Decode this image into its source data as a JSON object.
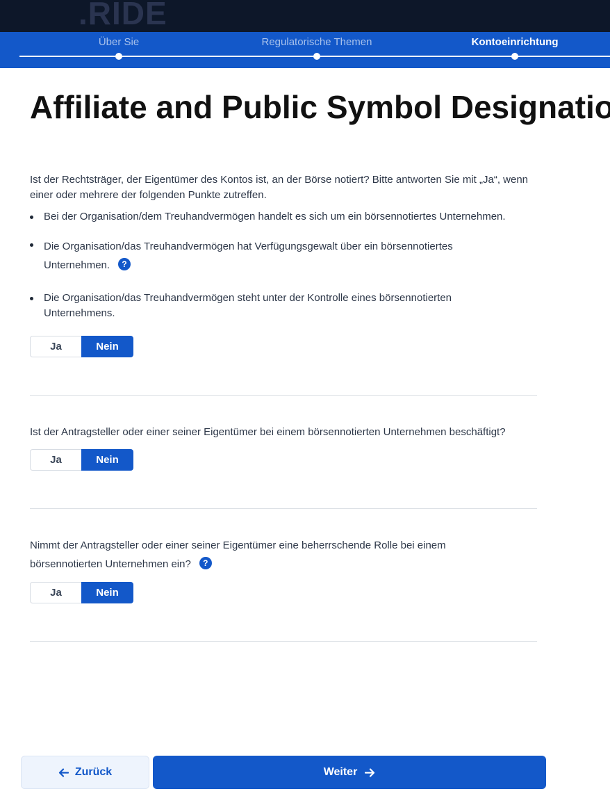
{
  "brand": {
    "logo_text": ".RIDE"
  },
  "stepper": {
    "steps": [
      {
        "label": "Über Sie",
        "state": "completed"
      },
      {
        "label": "Regulatorische Themen",
        "state": "completed"
      },
      {
        "label": "Kontoeinrichtung",
        "state": "active"
      }
    ]
  },
  "page": {
    "title": "Affiliate and Public Symbol Designation"
  },
  "questions": [
    {
      "text": "Ist der Rechtsträger, der Eigentümer des Kontos ist, an der Börse notiert? Bitte antworten Sie mit „Ja“, wenn einer oder mehrere der folgenden Punkte zutreffen.",
      "bullets": [
        "Bei der Organisation/dem Treuhandvermögen handelt es sich um ein börsennotiertes Unternehmen.",
        "Die Organisation/das Treuhandvermögen hat Verfügungsgewalt über ein börsennotiertes Unternehmen.",
        "Die Organisation/das Treuhandvermögen steht unter der Kontrolle eines börsennotierten Unternehmens."
      ],
      "options": [
        "Ja",
        "Nein"
      ],
      "selected": "Nein"
    },
    {
      "text": "Ist der Antragsteller oder einer seiner Eigentümer bei einem börsennotierten Unternehmen beschäftigt?",
      "options": [
        "Ja",
        "Nein"
      ],
      "selected": "Nein"
    },
    {
      "text": "Nimmt der Antragsteller oder einer seiner Eigentümer eine beherrschende Rolle bei einem börsennotierten Unternehmen ein?",
      "options": [
        "Ja",
        "Nein"
      ],
      "selected": "Nein"
    }
  ],
  "help_icon_glyph": "?",
  "footer": {
    "back_label": "Zurück",
    "next_label": "Weiter"
  },
  "colors": {
    "primary": "#1358c9",
    "header_bg": "#0d1729",
    "back_bg": "#eef4fd"
  },
  "icons": {
    "back": "arrow-left-icon",
    "next": "arrow-right-icon",
    "help": "question-mark-icon"
  }
}
